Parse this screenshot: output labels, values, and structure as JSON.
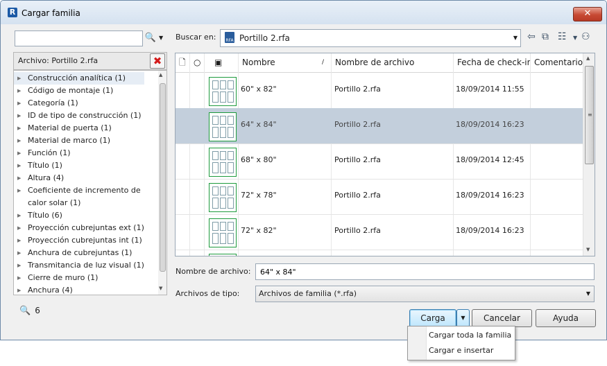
{
  "window": {
    "title": "Cargar familia",
    "close_label": "✕"
  },
  "search": {
    "placeholder": "",
    "value": ""
  },
  "filter": {
    "label": "Archivo: Portillo 2.rfa"
  },
  "tree": [
    "Construcción analítica  (1)",
    "Código de montaje  (1)",
    "Categoría  (1)",
    "ID de tipo de construcción  (1)",
    "Material de puerta  (1)",
    "Material de marco  (1)",
    "Función  (1)",
    "Título  (1)",
    "Altura  (4)",
    "Coeficiente de incremento de",
    "calor solar  (1)",
    "Título  (6)",
    "Proyección cubrejuntas ext  (1)",
    "Proyección cubrejuntas int  (1)",
    "Anchura de cubrejuntas  (1)",
    "Transmitancia de luz visual  (1)",
    "Cierre de muro  (1)",
    "Anchura  (4)"
  ],
  "result_count": "6",
  "look_in": {
    "label": "Buscar en:",
    "value": "Portillo 2.rfa",
    "icon_text": "RFA"
  },
  "columns": {
    "name": "Nombre",
    "filename": "Nombre de archivo",
    "date": "Fecha de check-in",
    "comment": "Comentario"
  },
  "rows": [
    {
      "name": "60\" x 82\"",
      "file": "Portillo 2.rfa",
      "date": "18/09/2014 11:55"
    },
    {
      "name": "64\" x 84\"",
      "file": "Portillo 2.rfa",
      "date": "18/09/2014 16:23"
    },
    {
      "name": "68\" x 80\"",
      "file": "Portillo 2.rfa",
      "date": "18/09/2014 12:45"
    },
    {
      "name": "72\" x 78\"",
      "file": "Portillo 2.rfa",
      "date": "18/09/2014 16:23"
    },
    {
      "name": "72\" x 82\"",
      "file": "Portillo 2.rfa",
      "date": "18/09/2014 16:23"
    }
  ],
  "filename": {
    "label": "Nombre de archivo:",
    "value": "64\" x 84\""
  },
  "filetype": {
    "label": "Archivos de tipo:",
    "value": "Archivos de familia (*.rfa)"
  },
  "buttons": {
    "load": "Carga",
    "cancel": "Cancelar",
    "help": "Ayuda"
  },
  "load_menu": [
    "Cargar toda la familia",
    "Cargar e insertar"
  ]
}
